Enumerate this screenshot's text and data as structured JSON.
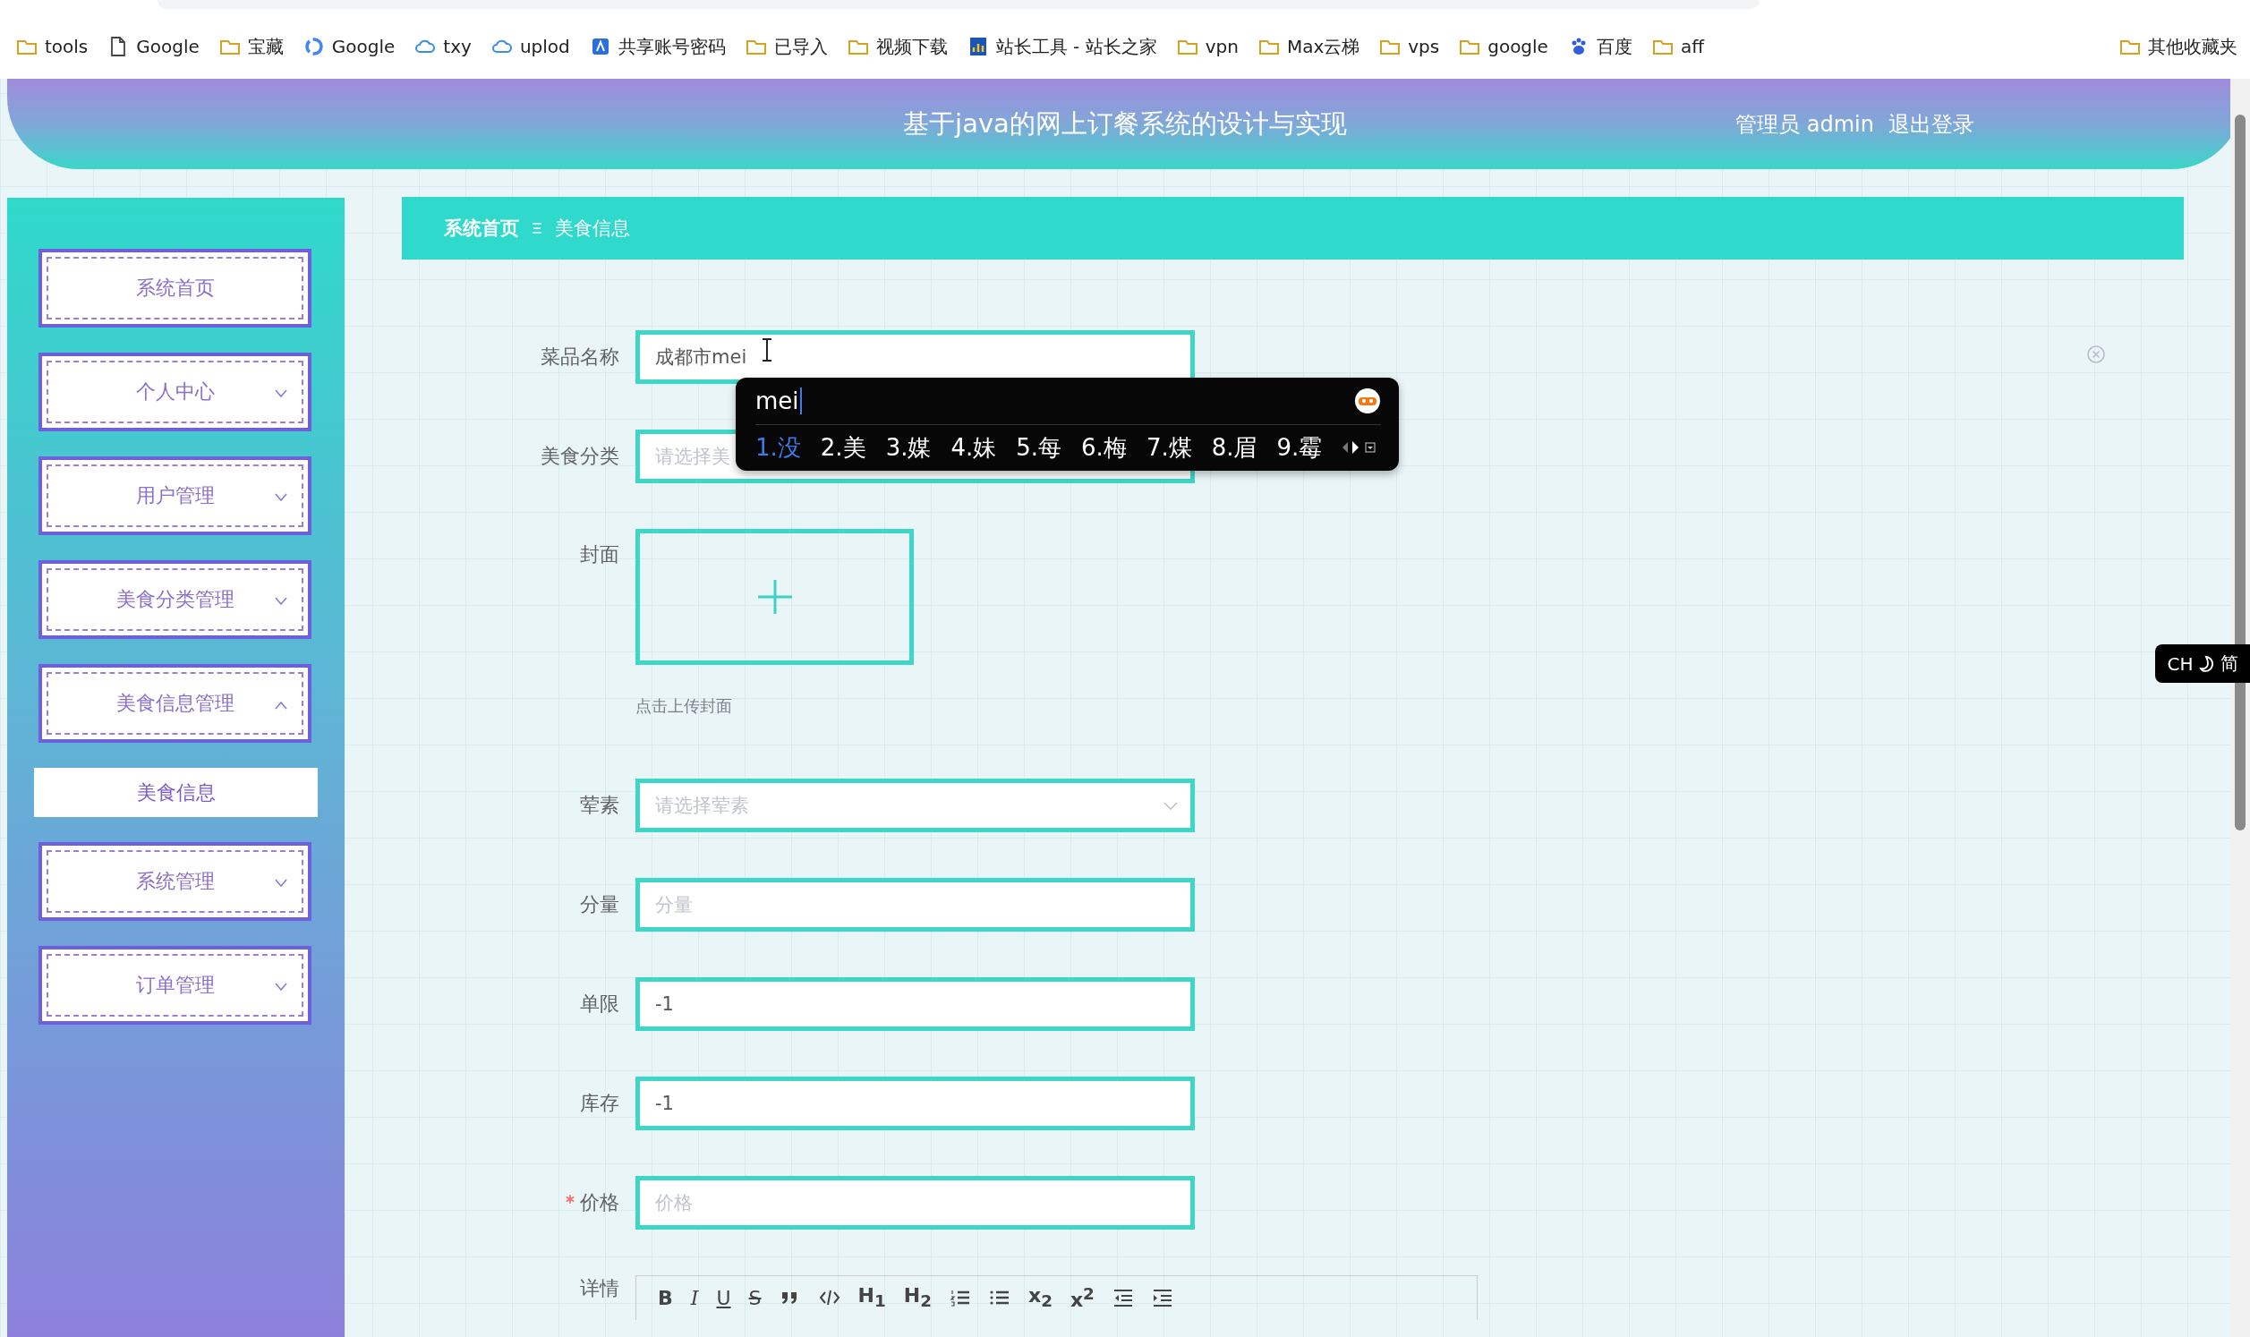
{
  "browser": {
    "bookmarks": [
      {
        "kind": "folder",
        "label": "tools"
      },
      {
        "kind": "page",
        "label": "Google"
      },
      {
        "kind": "folder",
        "label": "宝藏"
      },
      {
        "kind": "ring",
        "label": "Google"
      },
      {
        "kind": "cloud",
        "label": "txy"
      },
      {
        "kind": "cloud",
        "label": "uplod"
      },
      {
        "kind": "app",
        "label": "共享账号密码"
      },
      {
        "kind": "folder",
        "label": "已导入"
      },
      {
        "kind": "folder",
        "label": "视频下载"
      },
      {
        "kind": "chart",
        "label": "站长工具 - 站长之家"
      },
      {
        "kind": "folder",
        "label": "vpn"
      },
      {
        "kind": "folder",
        "label": "Max云梯"
      },
      {
        "kind": "folder",
        "label": "vps"
      },
      {
        "kind": "folder",
        "label": "google"
      },
      {
        "kind": "paw",
        "label": "百度"
      },
      {
        "kind": "folder",
        "label": "aff"
      }
    ],
    "other_bookmarks": {
      "kind": "folder",
      "label": "其他收藏夹"
    }
  },
  "header": {
    "title": "基于java的网上订餐系统的设计与实现",
    "user": "管理员 admin",
    "logout": "退出登录"
  },
  "sidebar": {
    "items": [
      {
        "kind": "link",
        "label": "系统首页",
        "selected": false
      },
      {
        "kind": "submenu",
        "label": "个人中心",
        "selected": false,
        "expanded": false
      },
      {
        "kind": "submenu",
        "label": "用户管理",
        "selected": false,
        "expanded": false
      },
      {
        "kind": "submenu",
        "label": "美食分类管理",
        "selected": false,
        "expanded": false
      },
      {
        "kind": "submenu",
        "label": "美食信息管理",
        "selected": false,
        "expanded": true,
        "children": [
          {
            "label": "美食信息",
            "selected": true
          }
        ]
      },
      {
        "kind": "submenu",
        "label": "系统管理",
        "selected": false,
        "expanded": false
      },
      {
        "kind": "submenu",
        "label": "订单管理",
        "selected": false,
        "expanded": false
      }
    ]
  },
  "breadcrumb": {
    "home": "系统首页",
    "current": "美食信息"
  },
  "form": {
    "fields": [
      {
        "kind": "input",
        "label": "菜品名称",
        "value": "成都市mei",
        "required": false
      },
      {
        "kind": "select",
        "label": "美食分类",
        "placeholder": "请选择美",
        "required": false
      },
      {
        "kind": "upload",
        "label": "封面",
        "hint": "点击上传封面",
        "required": false
      },
      {
        "kind": "select",
        "label": "荤素",
        "placeholder": "请选择荤素",
        "required": false
      },
      {
        "kind": "input",
        "label": "分量",
        "placeholder": "分量",
        "required": false
      },
      {
        "kind": "input",
        "label": "单限",
        "value": "-1",
        "required": false
      },
      {
        "kind": "input",
        "label": "库存",
        "value": "-1",
        "required": false
      },
      {
        "kind": "input",
        "label": "价格",
        "placeholder": "价格",
        "required": true
      },
      {
        "kind": "editor",
        "label": "详情",
        "required": false,
        "toolbar": [
          {
            "kind": "bold",
            "label": "B"
          },
          {
            "kind": "italic",
            "label": "I"
          },
          {
            "kind": "underline",
            "label": "U"
          },
          {
            "kind": "strike",
            "label": "S"
          },
          {
            "kind": "blockquote"
          },
          {
            "kind": "code"
          },
          {
            "kind": "heading",
            "label": "H$_{1}$"
          },
          {
            "kind": "heading",
            "label": "H$_{2}$"
          },
          {
            "kind": "ordered-list"
          },
          {
            "kind": "bullet-list"
          },
          {
            "kind": "script",
            "label": "x$_{2}$"
          },
          {
            "kind": "script",
            "label": "x$^{2}$"
          },
          {
            "kind": "outdent"
          },
          {
            "kind": "indent"
          }
        ]
      }
    ]
  },
  "ime": {
    "composition": "mei",
    "candidates": [
      {
        "label": "1.没",
        "selected": true
      },
      {
        "label": "2.美",
        "selected": false
      },
      {
        "label": "3.媒",
        "selected": false
      },
      {
        "label": "4.妹",
        "selected": false
      },
      {
        "label": "5.每",
        "selected": false
      },
      {
        "label": "6.梅",
        "selected": false
      },
      {
        "label": "7.煤",
        "selected": false
      },
      {
        "label": "8.眉",
        "selected": false
      },
      {
        "label": "9.霉",
        "selected": false
      }
    ]
  },
  "input_language": {
    "language": "CH",
    "mode": "简"
  }
}
